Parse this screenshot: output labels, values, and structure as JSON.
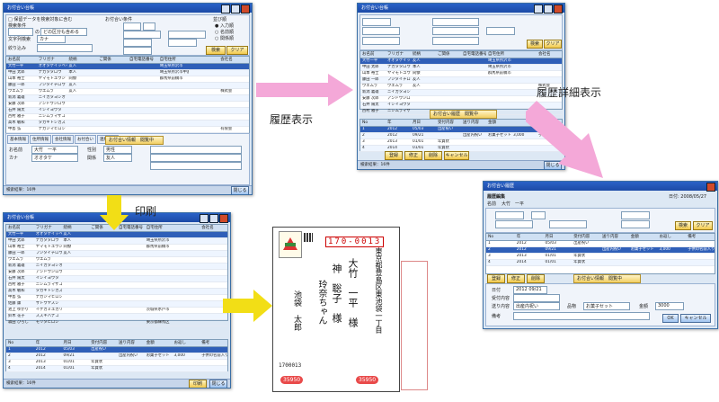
{
  "captions": {
    "history": "履歴表示",
    "history_detail": "履歴詳細表示",
    "print": "印刷"
  },
  "win1": {
    "title": "お付合い台帳",
    "include_inactive": "保留データを検索対象に含む",
    "search_label": "検索条件",
    "search_value": "指定なし",
    "inactive_value": "どの区分も含める",
    "char_search_label": "文字列検索",
    "char_search_value": "カナ",
    "filter_label": "絞り込み",
    "btn_search": "検索",
    "btn_clear": "クリア",
    "columns": [
      "お名前",
      "フリガナ",
      "続柄",
      "ご関係",
      "自宅電話番号",
      "自宅住所",
      "",
      "会社名"
    ],
    "rows": [
      [
        "大竹一平",
        "オオタケイッペイ",
        "友人",
        "",
        "",
        "埼玉県所沢市",
        "",
        ""
      ],
      [
        "中田 太郎",
        "ナカタタロウ",
        "本人",
        "",
        "",
        "埼玉県所沢市中富1-43-xx",
        "",
        ""
      ],
      [
        "山本 裕士",
        "ヤマモトユウジ",
        "同僚",
        "",
        "",
        "群馬県前橋市",
        "",
        ""
      ],
      [
        "藤田 一郎",
        "フジタイチロウ",
        "友人",
        "",
        "",
        "",
        "",
        ""
      ],
      [
        "ウエムラ",
        "ウエムラ",
        "友人",
        "",
        "",
        "",
        "",
        "株式会"
      ],
      [
        "新潟 義雄",
        "ニイガタヨシオ",
        "",
        "",
        "",
        "",
        "",
        ""
      ],
      [
        "安藤 次郎",
        "アンドウジロウ",
        "",
        "",
        "",
        "",
        "",
        ""
      ],
      [
        "石井 陽太",
        "イシイヨウタ",
        "",
        "",
        "",
        "",
        "",
        ""
      ],
      [
        "西村 雅子",
        "ニシムラマサコ",
        "",
        "",
        "",
        "",
        "",
        ""
      ],
      [
        "高木 敏和",
        "タカギトシカズ",
        "",
        "",
        "",
        "",
        "",
        ""
      ],
      [
        "中島 弘",
        "ナカジマヒロシ",
        "",
        "",
        "",
        "",
        "",
        "有限会"
      ],
      [
        "佐藤 康",
        "サトウヤスシ",
        "",
        "",
        "",
        "",
        "",
        ""
      ],
      [
        "池上 ゆかり",
        "イケガミユカリ",
        "",
        "",
        "",
        "茨城県水戸市",
        "",
        ""
      ]
    ],
    "tabs": [
      "基本情報",
      "住所情報",
      "会社情報",
      "お付合い",
      "連絡情報"
    ],
    "detail_title": "お付合い情報　閲覧中",
    "name_label": "お名前",
    "name_value": "大竹　一平",
    "kana_label": "カナ",
    "kana_value": "オオタケ",
    "gender_label": "性別",
    "gender_value": "男性",
    "relation_label": "関係",
    "relation_value": "友人",
    "status_text": "検索結果：16件",
    "btn_close": "閉じる"
  },
  "win2": {
    "title": "お付合い台帳",
    "detail_title": "お付合い履歴　閲覧中",
    "history_columns": [
      "No",
      "年",
      "月日",
      "受付内容",
      "送り内容",
      "金額",
      "",
      "備考"
    ],
    "history_rows": [
      [
        "1",
        "2012",
        "05/03",
        "出産祝い",
        "",
        "",
        "",
        ""
      ],
      [
        "2",
        "2012",
        "09/21",
        "",
        "出産内祝い",
        "お菓子セット",
        "3,000",
        "子供の名前入り"
      ],
      [
        "3",
        "2013",
        "01/01",
        "年賀状",
        "",
        "",
        "",
        ""
      ],
      [
        "4",
        "2014",
        "01/01",
        "年賀状",
        "",
        "",
        "",
        ""
      ]
    ],
    "btn_register": "登録",
    "btn_edit": "修正",
    "btn_delete": "削除",
    "btn_cancel": "キャンセル",
    "btn_close": "閉じる"
  },
  "win3": {
    "title": "お付合い履歴",
    "header": "履歴編集",
    "date_label": "日付: 2008/05/27",
    "name_label": "名前",
    "name_value": "大竹　一平",
    "columns": [
      "No",
      "年",
      "月日",
      "受付内容",
      "送り内容",
      "金額",
      "お返し",
      "備考"
    ],
    "rows": [
      [
        "1",
        "2012",
        "05/03",
        "出産祝い",
        "",
        "",
        "",
        ""
      ],
      [
        "2",
        "2012",
        "09/21",
        "",
        "出産内祝い",
        "お菓子セット",
        "3,000",
        "子供の名前入り"
      ],
      [
        "3",
        "2013",
        "01/01",
        "年賀状",
        "",
        "",
        "",
        ""
      ],
      [
        "4",
        "2014",
        "01/01",
        "年賀状",
        "",
        "",
        "",
        ""
      ]
    ],
    "btn_a": "登録",
    "btn_b": "修正",
    "btn_c": "削除",
    "section_title": "お付合い情報　閲覧中",
    "f_date": "日付",
    "f_date_val": "2012 09/21",
    "f_receive": "受付内容",
    "f_send": "送り内容",
    "f_send_val": "出産内祝い",
    "f_item": "品物",
    "f_item_val": "お菓子セット",
    "f_amount": "金額",
    "f_amount_val": "3000",
    "f_note": "備考",
    "btn_ok": "OK",
    "btn_cancel": "キャンセル"
  },
  "win4": {
    "title": "お付合い台帳",
    "columns": [
      "お名前",
      "フリガナ",
      "続柄",
      "ご関係",
      "自宅電話番号",
      "自宅住所",
      "",
      "会社名"
    ],
    "rows": [
      [
        "大竹一平",
        "オオタケイッペイ",
        "友人",
        "",
        "",
        "",
        "",
        ""
      ],
      [
        "中田 太郎",
        "ナカタタロウ",
        "本人",
        "",
        "",
        "埼玉県所沢市",
        "",
        ""
      ],
      [
        "山本 裕士",
        "ヤマモトユウジ",
        "同僚",
        "",
        "",
        "群馬県前橋市",
        "",
        ""
      ],
      [
        "藤田 一郎",
        "フジタイチロウ",
        "友人",
        "",
        "",
        "",
        "",
        ""
      ],
      [
        "ウエムラ",
        "ウエムラ",
        "",
        "",
        "",
        "",
        "",
        ""
      ],
      [
        "新潟 義雄",
        "ニイガタヨシオ",
        "",
        "",
        "",
        "",
        "",
        ""
      ],
      [
        "安藤 次郎",
        "アンドウジロウ",
        "",
        "",
        "",
        "",
        "",
        ""
      ],
      [
        "石井 陽太",
        "イシイヨウタ",
        "",
        "",
        "",
        "",
        "",
        ""
      ],
      [
        "西村 雅子",
        "ニシムラマサコ",
        "",
        "",
        "",
        "",
        "",
        ""
      ],
      [
        "高木 敏和",
        "タカギトシカズ",
        "",
        "",
        "",
        "",
        "",
        ""
      ],
      [
        "中島 弘",
        "ナカジマヒロシ",
        "",
        "",
        "",
        "",
        "",
        ""
      ],
      [
        "佐藤 康",
        "サトウヤスシ",
        "",
        "",
        "",
        "",
        "",
        ""
      ],
      [
        "池上 ゆかり",
        "イケガミユカリ",
        "",
        "",
        "",
        "茨城県水戸市",
        "",
        ""
      ],
      [
        "鈴木 花子",
        "スズキハナコ",
        "",
        "",
        "",
        "",
        "",
        ""
      ],
      [
        "森田 ひろし",
        "モリタヒロシ",
        "",
        "",
        "",
        "東京都練馬区",
        "",
        ""
      ]
    ],
    "hist_columns": [
      "No",
      "年",
      "月日",
      "受付内容",
      "送り内容",
      "金額",
      "お返し",
      "備考"
    ],
    "hist_rows": [
      [
        "1",
        "2012",
        "05/03",
        "出産祝い",
        "",
        "",
        "",
        ""
      ],
      [
        "2",
        "2012",
        "09/21",
        "",
        "出産内祝い",
        "お菓子セット",
        "3,000",
        "子供の名前入り"
      ],
      [
        "3",
        "2013",
        "01/01",
        "年賀状",
        "",
        "",
        "",
        ""
      ],
      [
        "4",
        "2014",
        "01/01",
        "年賀状",
        "",
        "",
        "",
        ""
      ]
    ],
    "status_text": "検索結果：16件",
    "btn_print": "印刷",
    "btn_close": "閉じる"
  },
  "envelope": {
    "zip_top": "170-0013",
    "zip_bottom": "1700013",
    "addr": "東京都豊島区東池袋一丁目",
    "name1": "大竹　一平　様",
    "name2": "神　聡子　様",
    "name3": "玲奈ちゃん",
    "sender": "池袋　太郎",
    "badge1": "35950",
    "badge2": "35950"
  }
}
